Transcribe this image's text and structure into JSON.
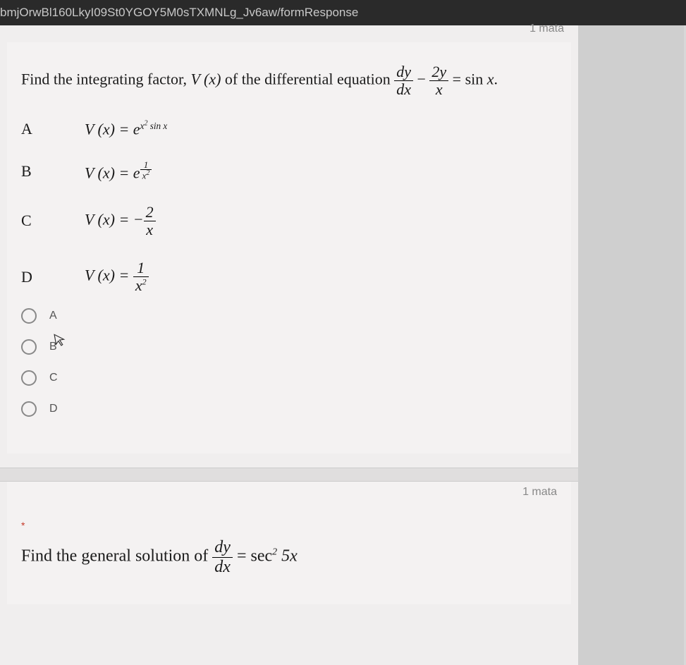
{
  "url_text": "bmjOrwBl160LkyI09St0YGOY5M0sTXMNLg_Jv6aw/formResponse",
  "points_label_top": "1 mata",
  "points_label_bottom": "1 mata",
  "question1": {
    "prefix": "Find the integrating factor, ",
    "vx": "V (x)",
    "mid": " of the differential equation ",
    "frac1_num": "dy",
    "frac1_den": "dx",
    "minus": " − ",
    "frac2_num": "2y",
    "frac2_den": "x",
    "eq": " = sin ",
    "xvar": "x",
    "dot": "."
  },
  "opts": {
    "A": {
      "letter": "A",
      "lhs": "V (x) = e",
      "exp_main": "x",
      "exp_sup": "2",
      "exp_tail": " sin x"
    },
    "B": {
      "letter": "B",
      "lhs": "V (x) = e",
      "fnum": "1",
      "fden_base": "x",
      "fden_sup": "2"
    },
    "C": {
      "letter": "C",
      "lhs": "V (x) = −",
      "fnum": "2",
      "fden": "x"
    },
    "D": {
      "letter": "D",
      "lhs": "V (x) = ",
      "fnum": "1",
      "fden_base": "x",
      "fden_sup": "2"
    }
  },
  "radios": {
    "a": "A",
    "b": "B",
    "c": "C",
    "d": "D"
  },
  "asterisk": "*",
  "question2": {
    "prefix": "Find the general solution of ",
    "frac_num": "dy",
    "frac_den": "dx",
    "eq": " = sec",
    "sup": "2",
    "tail": " 5x"
  },
  "chart_data": {
    "type": "table",
    "title": "Multiple choice question: integrating factor of dy/dx - 2y/x = sin x",
    "options": [
      {
        "label": "A",
        "expression": "V(x) = e^{x^2 sin x}"
      },
      {
        "label": "B",
        "expression": "V(x) = e^{1/x^2}"
      },
      {
        "label": "C",
        "expression": "V(x) = -2/x"
      },
      {
        "label": "D",
        "expression": "V(x) = 1/x^2"
      }
    ],
    "followup": "Find the general solution of dy/dx = sec^2 5x"
  }
}
